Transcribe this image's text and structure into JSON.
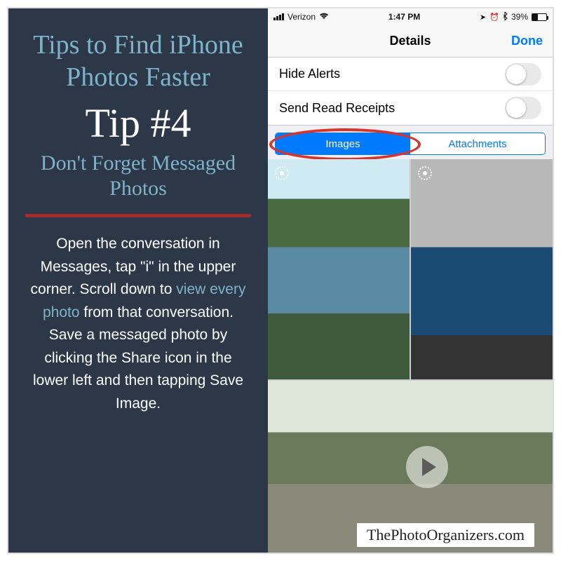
{
  "left": {
    "title": "Tips to Find iPhone Photos Faster",
    "tip_number": "Tip #4",
    "subtitle": "Don't Forget Messaged Photos",
    "body_1": "Open the conversation in Messages, tap \"i\" in the upper corner.  Scroll down to ",
    "body_accent": "view every photo",
    "body_2": " from that conversation.",
    "body_3": "Save a messaged photo by clicking the Share icon in the lower left and then tapping Save Image."
  },
  "statusbar": {
    "carrier": "Verizon",
    "time": "1:47 PM",
    "battery_pct": "39%"
  },
  "navbar": {
    "title": "Details",
    "done": "Done"
  },
  "settings": {
    "hide_alerts": "Hide Alerts",
    "read_receipts": "Send Read Receipts"
  },
  "segmented": {
    "images": "Images",
    "attachments": "Attachments"
  },
  "footer": "ThePhotoOrganizers.com"
}
